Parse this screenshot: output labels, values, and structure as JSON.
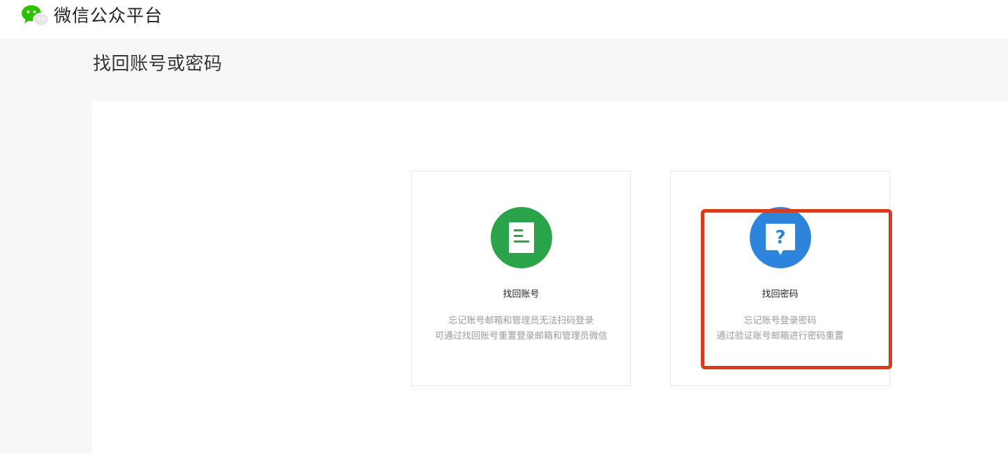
{
  "header": {
    "brand": "微信公众平台",
    "logo_icon": "wechat-logo-icon"
  },
  "page": {
    "title": "找回账号或密码"
  },
  "options": [
    {
      "title": "找回账号",
      "desc_line1": "忘记账号邮箱和管理员无法扫码登录",
      "desc_line2": "可通过找回账号重置登录邮箱和管理员微信",
      "icon": "document-icon",
      "color": "#2aa34a"
    },
    {
      "title": "找回密码",
      "desc_line1": "忘记账号登录密码",
      "desc_line2": "通过验证账号邮箱进行密码重置",
      "icon": "question-bubble-icon",
      "color": "#2c85db"
    }
  ],
  "colors": {
    "highlight": "#d53d1e",
    "background": "#f6f7f9"
  }
}
